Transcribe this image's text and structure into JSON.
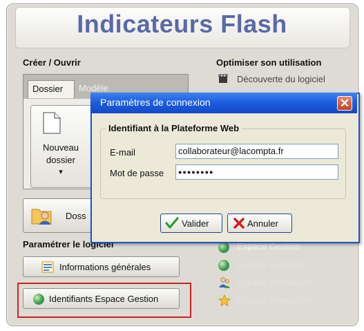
{
  "app": {
    "title": "Indicateurs Flash"
  },
  "left": {
    "create_open_title": "Créer / Ouvrir",
    "tabs": [
      {
        "label": "Dossier"
      },
      {
        "label": "Modèle"
      }
    ],
    "new_folder_button": {
      "line1": "Nouveau",
      "line2": "dossier",
      "arrow": "▾"
    },
    "folder_button_label": "Doss",
    "settings_title": "Paramétrer le logiciel",
    "general_info_label": "Informations générales",
    "credentials_label": "Identifiants Espace Gestion"
  },
  "right": {
    "optimize_title": "Optimiser son utilisation",
    "discovery_label": "Découverte du logiciel",
    "links": [
      {
        "label": "Espace Gestion",
        "icon": "globe-icon"
      },
      {
        "label": "Espace Logiciels",
        "icon": "globe-icon"
      },
      {
        "label": "Espace Utilisateurs",
        "icon": "users-icon"
      },
      {
        "label": "Espace Innovation",
        "icon": "star-icon"
      }
    ]
  },
  "dialog": {
    "title": "Paramètres de connexion",
    "close_symbol": "✕",
    "group_title": "Identifiant à la Plateforme Web",
    "email_label": "E-mail",
    "email_value": "collaborateur@lacompta.fr",
    "password_label": "Mot de passe",
    "password_value": "●●●●●●●●",
    "ok_label": "Valider",
    "cancel_label": "Annuler"
  },
  "colors": {
    "title_blue": "#5a6aa8",
    "dialog_blue": "#1d5fde",
    "highlight_red": "#cc2222"
  }
}
